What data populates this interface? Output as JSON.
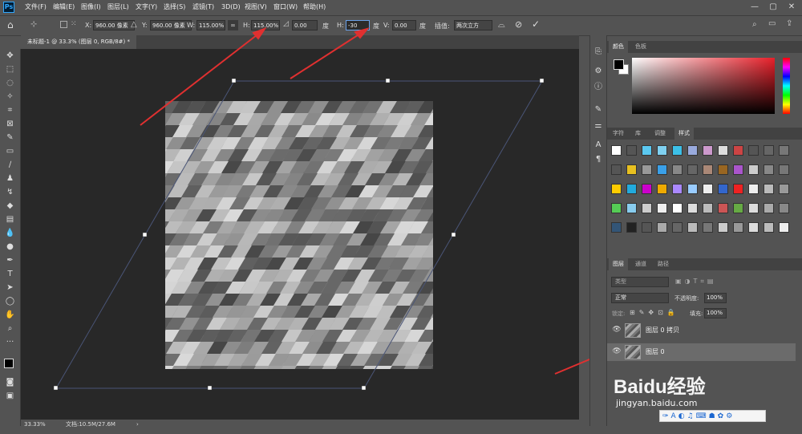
{
  "app": {
    "logo": "Ps"
  },
  "menu": [
    "文件(F)",
    "编辑(E)",
    "图像(I)",
    "图层(L)",
    "文字(Y)",
    "选择(S)",
    "滤镜(T)",
    "3D(D)",
    "视图(V)",
    "窗口(W)",
    "帮助(H)"
  ],
  "options": {
    "x_label": "X:",
    "x_value": "960.00 像素",
    "y_label": "Y:",
    "y_value": "960.00 像素",
    "w_label": "W:",
    "w_value": "115.00%",
    "h_label": "H:",
    "h_value": "115.00%",
    "angle_value": "0.00",
    "angle_unit": "度",
    "hskew_label": "H:",
    "hskew_value": "-30",
    "hskew_unit": "度",
    "vskew_label": "V:",
    "vskew_value": "0.00",
    "vskew_unit": "度",
    "interp_label": "插值:",
    "interp_value": "两次立方"
  },
  "document": {
    "tab_title": "未标题-1 @ 33.3% (图层 0, RGB/8#) *"
  },
  "status": {
    "zoom": "33.33%",
    "doc_info": "文档:10.5M/27.6M"
  },
  "panels": {
    "color_tabs": [
      "颜色",
      "色板"
    ],
    "style_tabs": [
      "字符",
      "库",
      "调整",
      "样式"
    ],
    "layer_tabs": [
      "图层",
      "通道",
      "路径"
    ],
    "layer_filter": "类型",
    "blend_mode": "正常",
    "opacity_label": "不透明度:",
    "opacity_value": "100%",
    "lock_label": "锁定:",
    "fill_label": "填充:",
    "fill_value": "100%",
    "layers": [
      {
        "name": "图层 0 拷贝",
        "selected": false
      },
      {
        "name": "图层 0",
        "selected": true
      }
    ]
  },
  "watermark": {
    "text": "Baidu经验",
    "url": "jingyan.baidu.com"
  },
  "colors": {
    "accent": "#e03030",
    "selection": "#6aa0e8"
  }
}
